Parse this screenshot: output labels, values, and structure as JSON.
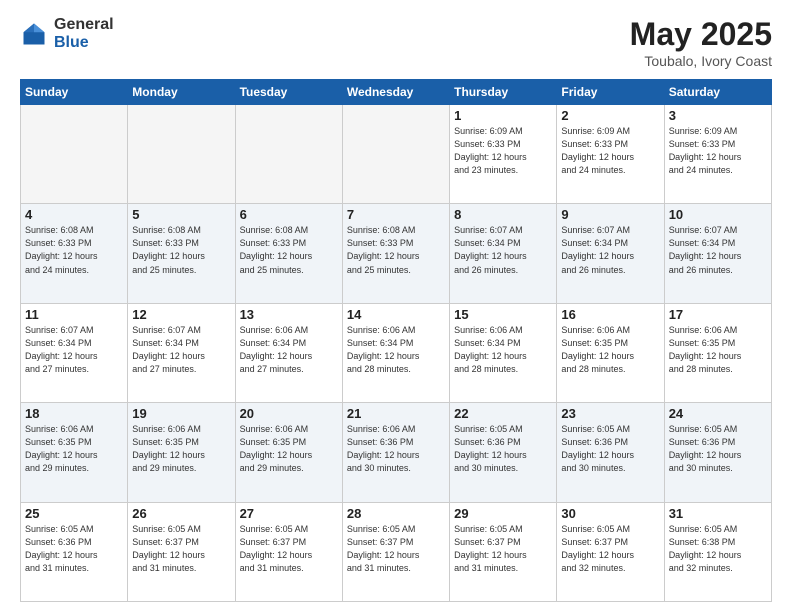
{
  "logo": {
    "general": "General",
    "blue": "Blue"
  },
  "title": {
    "month_year": "May 2025",
    "location": "Toubalo, Ivory Coast"
  },
  "weekdays": [
    "Sunday",
    "Monday",
    "Tuesday",
    "Wednesday",
    "Thursday",
    "Friday",
    "Saturday"
  ],
  "weeks": [
    [
      {
        "day": "",
        "info": ""
      },
      {
        "day": "",
        "info": ""
      },
      {
        "day": "",
        "info": ""
      },
      {
        "day": "",
        "info": ""
      },
      {
        "day": "1",
        "info": "Sunrise: 6:09 AM\nSunset: 6:33 PM\nDaylight: 12 hours\nand 23 minutes."
      },
      {
        "day": "2",
        "info": "Sunrise: 6:09 AM\nSunset: 6:33 PM\nDaylight: 12 hours\nand 24 minutes."
      },
      {
        "day": "3",
        "info": "Sunrise: 6:09 AM\nSunset: 6:33 PM\nDaylight: 12 hours\nand 24 minutes."
      }
    ],
    [
      {
        "day": "4",
        "info": "Sunrise: 6:08 AM\nSunset: 6:33 PM\nDaylight: 12 hours\nand 24 minutes."
      },
      {
        "day": "5",
        "info": "Sunrise: 6:08 AM\nSunset: 6:33 PM\nDaylight: 12 hours\nand 25 minutes."
      },
      {
        "day": "6",
        "info": "Sunrise: 6:08 AM\nSunset: 6:33 PM\nDaylight: 12 hours\nand 25 minutes."
      },
      {
        "day": "7",
        "info": "Sunrise: 6:08 AM\nSunset: 6:33 PM\nDaylight: 12 hours\nand 25 minutes."
      },
      {
        "day": "8",
        "info": "Sunrise: 6:07 AM\nSunset: 6:34 PM\nDaylight: 12 hours\nand 26 minutes."
      },
      {
        "day": "9",
        "info": "Sunrise: 6:07 AM\nSunset: 6:34 PM\nDaylight: 12 hours\nand 26 minutes."
      },
      {
        "day": "10",
        "info": "Sunrise: 6:07 AM\nSunset: 6:34 PM\nDaylight: 12 hours\nand 26 minutes."
      }
    ],
    [
      {
        "day": "11",
        "info": "Sunrise: 6:07 AM\nSunset: 6:34 PM\nDaylight: 12 hours\nand 27 minutes."
      },
      {
        "day": "12",
        "info": "Sunrise: 6:07 AM\nSunset: 6:34 PM\nDaylight: 12 hours\nand 27 minutes."
      },
      {
        "day": "13",
        "info": "Sunrise: 6:06 AM\nSunset: 6:34 PM\nDaylight: 12 hours\nand 27 minutes."
      },
      {
        "day": "14",
        "info": "Sunrise: 6:06 AM\nSunset: 6:34 PM\nDaylight: 12 hours\nand 28 minutes."
      },
      {
        "day": "15",
        "info": "Sunrise: 6:06 AM\nSunset: 6:34 PM\nDaylight: 12 hours\nand 28 minutes."
      },
      {
        "day": "16",
        "info": "Sunrise: 6:06 AM\nSunset: 6:35 PM\nDaylight: 12 hours\nand 28 minutes."
      },
      {
        "day": "17",
        "info": "Sunrise: 6:06 AM\nSunset: 6:35 PM\nDaylight: 12 hours\nand 28 minutes."
      }
    ],
    [
      {
        "day": "18",
        "info": "Sunrise: 6:06 AM\nSunset: 6:35 PM\nDaylight: 12 hours\nand 29 minutes."
      },
      {
        "day": "19",
        "info": "Sunrise: 6:06 AM\nSunset: 6:35 PM\nDaylight: 12 hours\nand 29 minutes."
      },
      {
        "day": "20",
        "info": "Sunrise: 6:06 AM\nSunset: 6:35 PM\nDaylight: 12 hours\nand 29 minutes."
      },
      {
        "day": "21",
        "info": "Sunrise: 6:06 AM\nSunset: 6:36 PM\nDaylight: 12 hours\nand 30 minutes."
      },
      {
        "day": "22",
        "info": "Sunrise: 6:05 AM\nSunset: 6:36 PM\nDaylight: 12 hours\nand 30 minutes."
      },
      {
        "day": "23",
        "info": "Sunrise: 6:05 AM\nSunset: 6:36 PM\nDaylight: 12 hours\nand 30 minutes."
      },
      {
        "day": "24",
        "info": "Sunrise: 6:05 AM\nSunset: 6:36 PM\nDaylight: 12 hours\nand 30 minutes."
      }
    ],
    [
      {
        "day": "25",
        "info": "Sunrise: 6:05 AM\nSunset: 6:36 PM\nDaylight: 12 hours\nand 31 minutes."
      },
      {
        "day": "26",
        "info": "Sunrise: 6:05 AM\nSunset: 6:37 PM\nDaylight: 12 hours\nand 31 minutes."
      },
      {
        "day": "27",
        "info": "Sunrise: 6:05 AM\nSunset: 6:37 PM\nDaylight: 12 hours\nand 31 minutes."
      },
      {
        "day": "28",
        "info": "Sunrise: 6:05 AM\nSunset: 6:37 PM\nDaylight: 12 hours\nand 31 minutes."
      },
      {
        "day": "29",
        "info": "Sunrise: 6:05 AM\nSunset: 6:37 PM\nDaylight: 12 hours\nand 31 minutes."
      },
      {
        "day": "30",
        "info": "Sunrise: 6:05 AM\nSunset: 6:37 PM\nDaylight: 12 hours\nand 32 minutes."
      },
      {
        "day": "31",
        "info": "Sunrise: 6:05 AM\nSunset: 6:38 PM\nDaylight: 12 hours\nand 32 minutes."
      }
    ]
  ]
}
